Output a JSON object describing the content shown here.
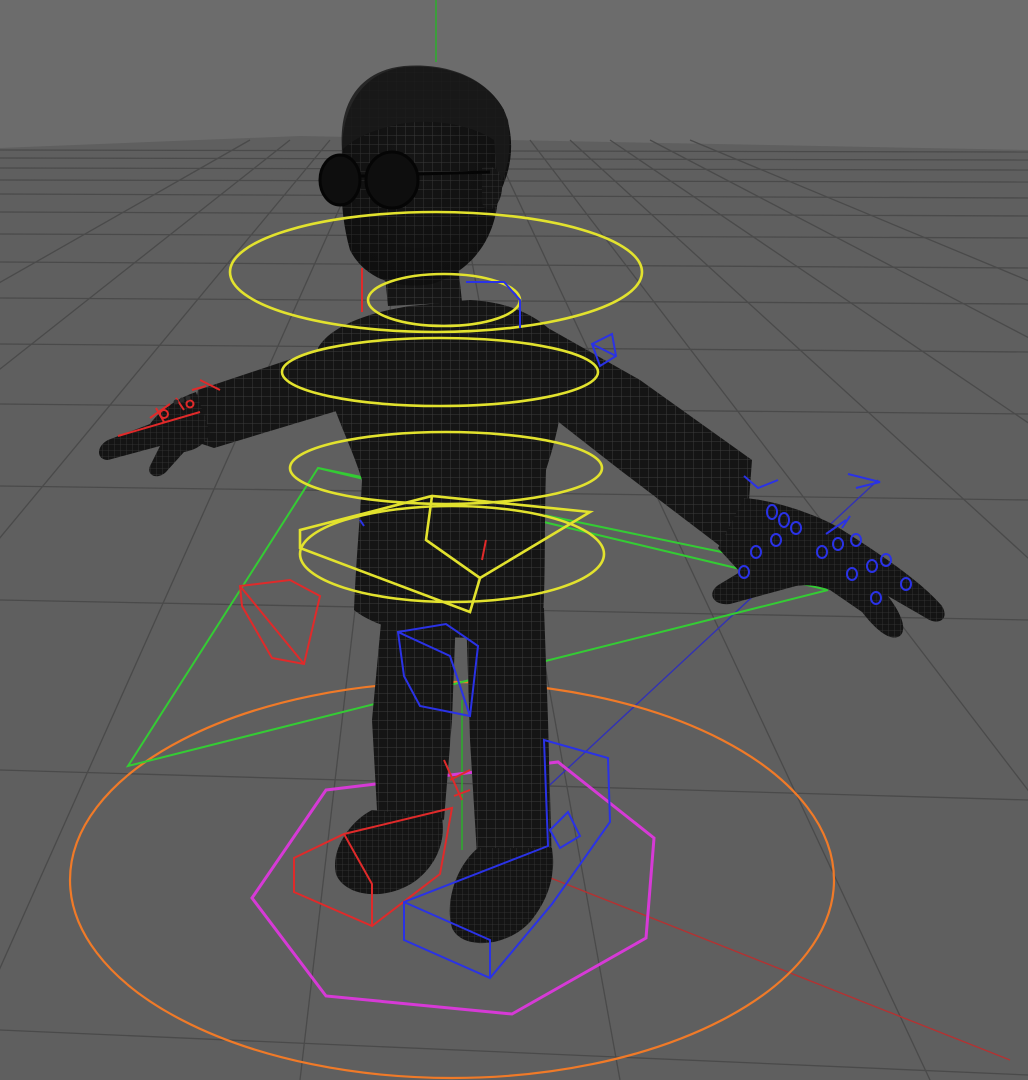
{
  "viewport": {
    "mode": "3d-viewport",
    "shading": "wireframe-on-shaded",
    "grid": true,
    "colors": {
      "sky": "#6c6c6c",
      "floor": "#5f5f5f",
      "grid_line": "#4a4a4a",
      "mesh_fill": "#151515",
      "mesh_wire": "#3b3b3b",
      "torso_controls": "#e2e22e",
      "left_side_controls": "#e02a2a",
      "right_side_controls": "#2a32e6",
      "center_controls": "#2ad02a",
      "root_control": "#f07a28",
      "foot_root_control": "#d63ad6",
      "axis_y": "#28b428",
      "axis_x": "#b43232",
      "axis_z": "#3232b4"
    }
  },
  "character": {
    "pose": "T-pose",
    "accessories": [
      "round-glasses"
    ]
  },
  "rig": {
    "controls": [
      {
        "kind": "head-ring",
        "color": "yellow"
      },
      {
        "kind": "neck-ring",
        "color": "yellow"
      },
      {
        "kind": "chest-ring",
        "color": "yellow"
      },
      {
        "kind": "spine-ring",
        "color": "yellow"
      },
      {
        "kind": "hip-ring",
        "color": "yellow"
      },
      {
        "kind": "pelvis-box",
        "color": "yellow"
      },
      {
        "kind": "center-of-gravity-triangle",
        "color": "green"
      },
      {
        "kind": "ground-circle",
        "color": "orange"
      },
      {
        "kind": "feet-octagon",
        "color": "magenta"
      },
      {
        "kind": "left-foot-box",
        "color": "red"
      },
      {
        "kind": "right-foot-box",
        "color": "blue"
      },
      {
        "kind": "left-knee-pole",
        "color": "red"
      },
      {
        "kind": "right-knee-pole",
        "color": "blue"
      },
      {
        "kind": "left-hand-fingers",
        "color": "red"
      },
      {
        "kind": "right-hand-fingers",
        "color": "blue"
      }
    ]
  }
}
